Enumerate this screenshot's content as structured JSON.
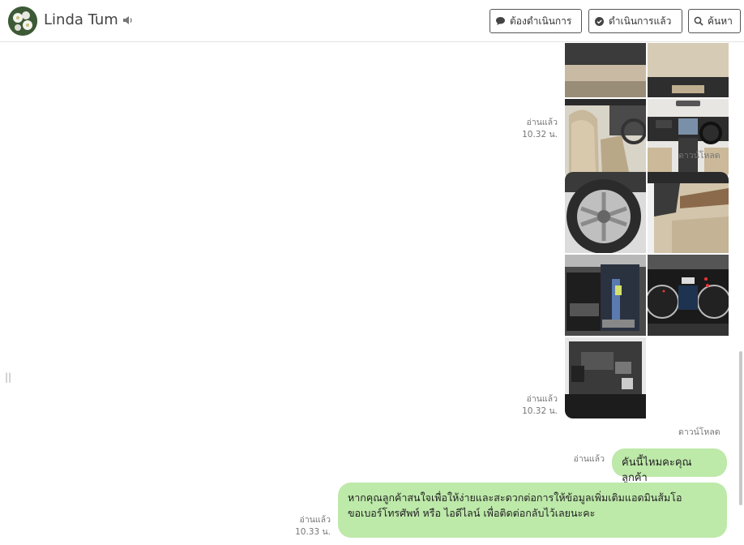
{
  "header": {
    "contact_name": "Linda Tum",
    "buttons": {
      "todo": "ต้องดำเนินการ",
      "done": "ดำเนินการแล้ว",
      "search": "ค้นหา"
    }
  },
  "messages": [
    {
      "type": "image-group",
      "status": "อ่านแล้ว",
      "time": "10.32 น.",
      "action": "ดาวน์โหลด"
    },
    {
      "type": "image-group",
      "status": "อ่านแล้ว",
      "time": "10.32 น.",
      "action": "ดาวน์โหลด"
    },
    {
      "type": "text",
      "status": "อ่านแล้ว",
      "text": "คันนี้ไหมคะคุณลูกค้า"
    },
    {
      "type": "text",
      "status": "อ่านแล้ว",
      "time": "10.33 น.",
      "lines": [
        "หากคุณลูกค้าสนใจเพื่อให้ง่ายและสะดวกต่อการให้ข้อมูลเพิ่มเติมแอดมินส้มโอ",
        "ขอเบอร์โทรศัพท์ หรือ ไอดีไลน์ เพื่อติดต่อกลับไว้เลยนะคะ"
      ]
    }
  ],
  "colors": {
    "bubble": "#bde9a9",
    "border": "#555555"
  }
}
